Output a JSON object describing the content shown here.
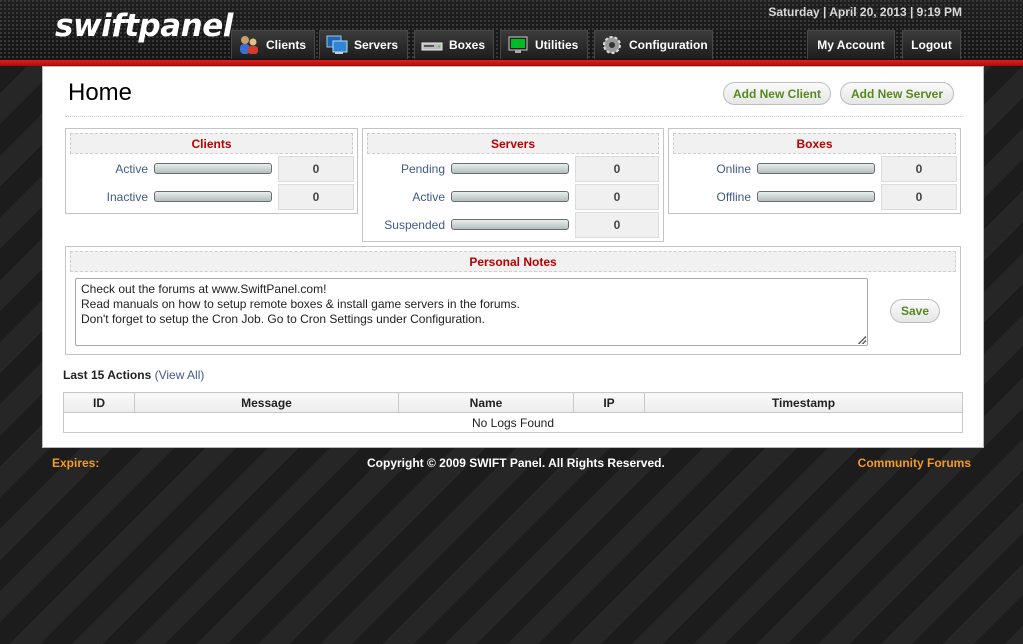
{
  "header": {
    "logo": "swiftpanel",
    "datetime": "Saturday | April 20, 2013 | 9:19 PM",
    "nav": [
      {
        "label": "Clients",
        "icon": "clients-icon"
      },
      {
        "label": "Servers",
        "icon": "servers-icon"
      },
      {
        "label": "Boxes",
        "icon": "boxes-icon"
      },
      {
        "label": "Utilities",
        "icon": "utilities-icon"
      },
      {
        "label": "Configuration",
        "icon": "gear-icon"
      }
    ],
    "account": {
      "my_account": "My Account",
      "logout": "Logout"
    }
  },
  "page": {
    "title": "Home",
    "add_client": "Add New Client",
    "add_server": "Add New Server"
  },
  "stats": {
    "clients": {
      "title": "Clients",
      "rows": [
        {
          "label": "Active",
          "value": "0"
        },
        {
          "label": "Inactive",
          "value": "0"
        }
      ]
    },
    "servers": {
      "title": "Servers",
      "rows": [
        {
          "label": "Pending",
          "value": "0"
        },
        {
          "label": "Active",
          "value": "0"
        },
        {
          "label": "Suspended",
          "value": "0"
        }
      ]
    },
    "boxes": {
      "title": "Boxes",
      "rows": [
        {
          "label": "Online",
          "value": "0"
        },
        {
          "label": "Offline",
          "value": "0"
        }
      ]
    }
  },
  "notes": {
    "title": "Personal Notes",
    "text": "Check out the forums at www.SwiftPanel.com!\nRead manuals on how to setup remote boxes & install game servers in the forums.\nDon't forget to setup the Cron Job. Go to Cron Settings under Configuration.",
    "save": "Save"
  },
  "actions": {
    "title": "Last 15 Actions",
    "view_all": "(View All)",
    "columns": [
      "ID",
      "Message",
      "Name",
      "IP",
      "Timestamp"
    ],
    "empty": "No Logs Found"
  },
  "footer": {
    "expires": "Expires:",
    "copyright": "Copyright © 2009 SWIFT Panel. All Rights Reserved.",
    "community": "Community Forums"
  },
  "colors": {
    "accent_red": "#b00000",
    "button_green": "#55891d",
    "footer_orange": "#f39a22",
    "link_blue": "#3f5a8c"
  }
}
